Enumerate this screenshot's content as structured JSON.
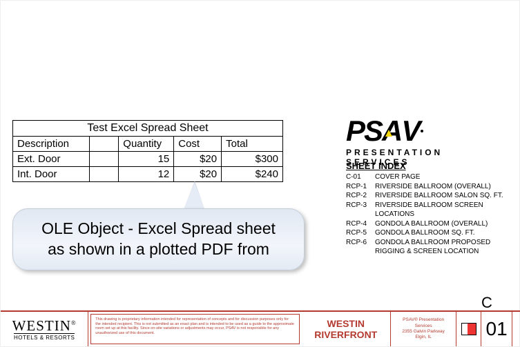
{
  "excel": {
    "title": "Test Excel Spread Sheet",
    "headers": {
      "desc": "Description",
      "qty": "Quantity",
      "cost": "Cost",
      "total": "Total"
    },
    "rows": [
      {
        "desc": "Ext. Door",
        "qty": "15",
        "cost": "$20",
        "total": "$300"
      },
      {
        "desc": "Int. Door",
        "qty": "12",
        "cost": "$20",
        "total": "$240"
      }
    ]
  },
  "callout": {
    "line1": "OLE Object - Excel Spread sheet",
    "line2": "as shown in a plotted PDF from"
  },
  "psav": {
    "word": "PSAV",
    "sub": "PRESENTATION SERVICES"
  },
  "sheet_index": {
    "title": "SHEET INDEX",
    "rows": [
      {
        "code": "C-01",
        "desc": "COVER PAGE"
      },
      {
        "code": "RCP-1",
        "desc": "RIVERSIDE BALLROOM (OVERALL)"
      },
      {
        "code": "RCP-2",
        "desc": "RIVERSIDE BALLROOM SALON SQ. FT."
      },
      {
        "code": "RCP-3",
        "desc": "RIVERSIDE BALLROOM SCREEN LOCATIONS"
      },
      {
        "code": "RCP-4",
        "desc": "GONDOLA BALLROOM (OVERALL)"
      },
      {
        "code": "RCP-5",
        "desc": "GONDOLA BALLROOM SQ. FT."
      },
      {
        "code": "RCP-6",
        "desc": "GONDOLA BALLROOM PROPOSED RIGGING & SCREEN LOCATION"
      }
    ]
  },
  "titleblock": {
    "westin1": "WESTIN",
    "westin2": "HOTELS & RESORTS",
    "disclaimer": "This drawing is proprietary information intended for representation of concepts and for discussion purposes only for the intended recipient. This is not submitted as an exact plan and is intended to be used as a guide to the approximate room set up at this facility. Since on-site variations or adjustments may occur, PSAV is not responsible for any unauthorized use of this document.",
    "project1": "WESTIN",
    "project2": "RIVERFRONT",
    "psav_small1": "PSAV® Presentation Services",
    "psav_small2": "2355 Galvin Parkway",
    "psav_small3": "Elgin, IL",
    "rev": "C",
    "sheet": "01"
  }
}
